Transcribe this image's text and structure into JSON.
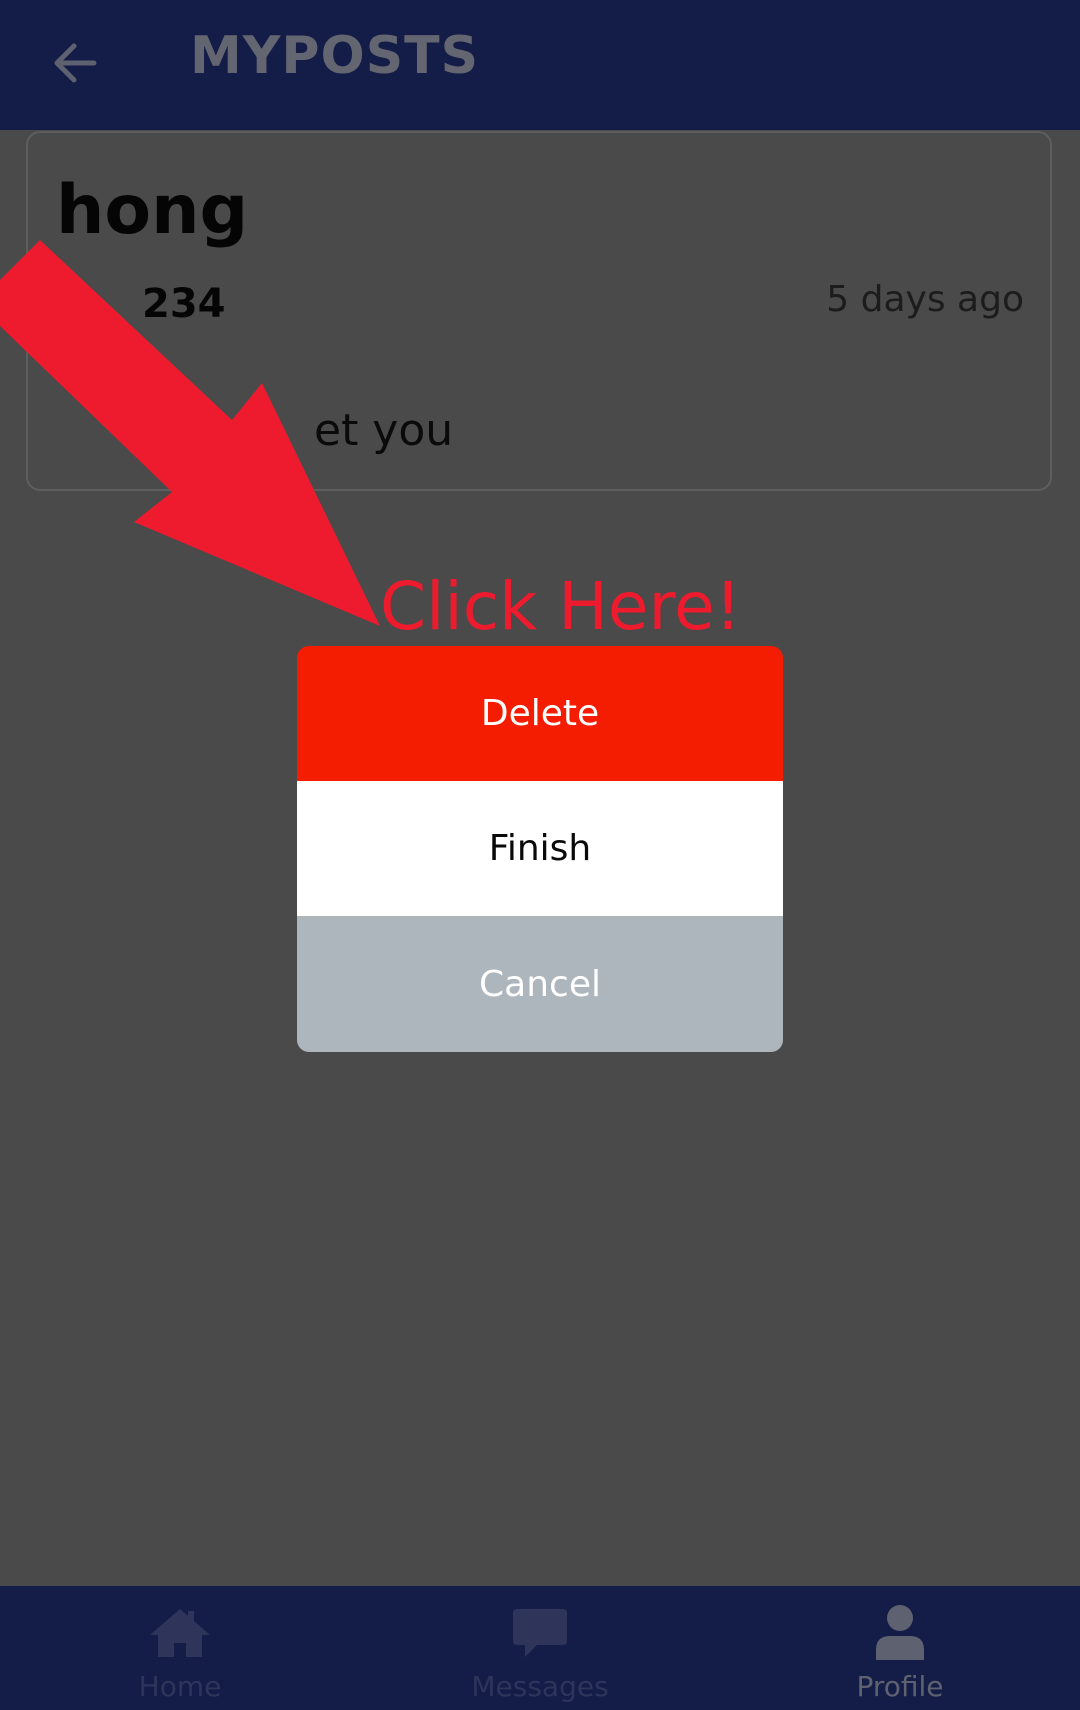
{
  "header": {
    "title": "MYPOSTS",
    "back_icon": "arrow-left-icon"
  },
  "post": {
    "author": "hong",
    "id": "234",
    "time": "5 days ago",
    "body": "et you"
  },
  "annotation": {
    "text": "Click Here!",
    "color": "#ee1b2e"
  },
  "dialog": {
    "delete_label": "Delete",
    "finish_label": "Finish",
    "cancel_label": "Cancel",
    "delete_color": "#f41d02",
    "cancel_color": "#adb5bd"
  },
  "nav": {
    "items": [
      {
        "label": "Home",
        "icon": "home-icon"
      },
      {
        "label": "Messages",
        "icon": "chat-bubble-icon"
      },
      {
        "label": "Profile",
        "icon": "user-icon"
      }
    ]
  },
  "colors": {
    "bar": "#141c48",
    "overlay_bg": "#4a4a4a"
  }
}
